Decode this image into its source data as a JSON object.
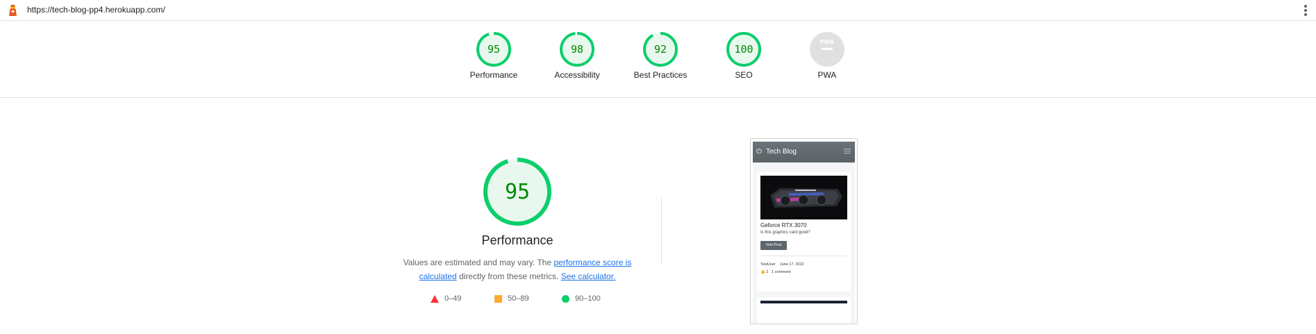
{
  "browser": {
    "url": "https://tech-blog-pp4.herokuapp.com/",
    "lighthouse_icon": "lighthouse-icon",
    "menu_icon": "kebab-menu-icon"
  },
  "summary": {
    "categories": [
      {
        "label": "Performance",
        "score": "95",
        "fraction": 0.95,
        "status": "pass"
      },
      {
        "label": "Accessibility",
        "score": "98",
        "fraction": 0.98,
        "status": "pass"
      },
      {
        "label": "Best Practices",
        "score": "92",
        "fraction": 0.92,
        "status": "pass"
      },
      {
        "label": "SEO",
        "score": "100",
        "fraction": 1.0,
        "status": "pass"
      },
      {
        "label": "PWA",
        "score": "PWA",
        "fraction": 0,
        "status": "na"
      }
    ]
  },
  "performance": {
    "score": "95",
    "fraction": 0.95,
    "title": "Performance",
    "desc_prefix": "Values are estimated and may vary. The ",
    "desc_link": "performance score is calculated",
    "desc_middle": " directly from these metrics. ",
    "desc_link2": "See calculator.",
    "legend": [
      {
        "shape": "triangle",
        "range": "0–49",
        "color": "#ff3333"
      },
      {
        "shape": "square",
        "range": "50–89",
        "color": "#ffaa33"
      },
      {
        "shape": "circle",
        "range": "90–100",
        "color": "#0cce6b"
      }
    ]
  },
  "screenshot": {
    "brand": "Tech Blog",
    "power_icon": "power-icon",
    "menu_icon": "hamburger-icon",
    "post_title": "Geforce RTX 3070",
    "post_subtitle": "Is this graphics card good?",
    "button": "Visit Post",
    "author": "TestUser",
    "date": "June 17, 2022",
    "likes": "2",
    "comments": "1 comment",
    "like_icon": "thumbs-up-icon"
  },
  "colors": {
    "pass": "#0cce6b",
    "pass_text": "#008800",
    "pass_bg": "#e8f8ee",
    "na": "#e0e0e0",
    "link": "#1a73e8",
    "accent": "#e8541e"
  }
}
